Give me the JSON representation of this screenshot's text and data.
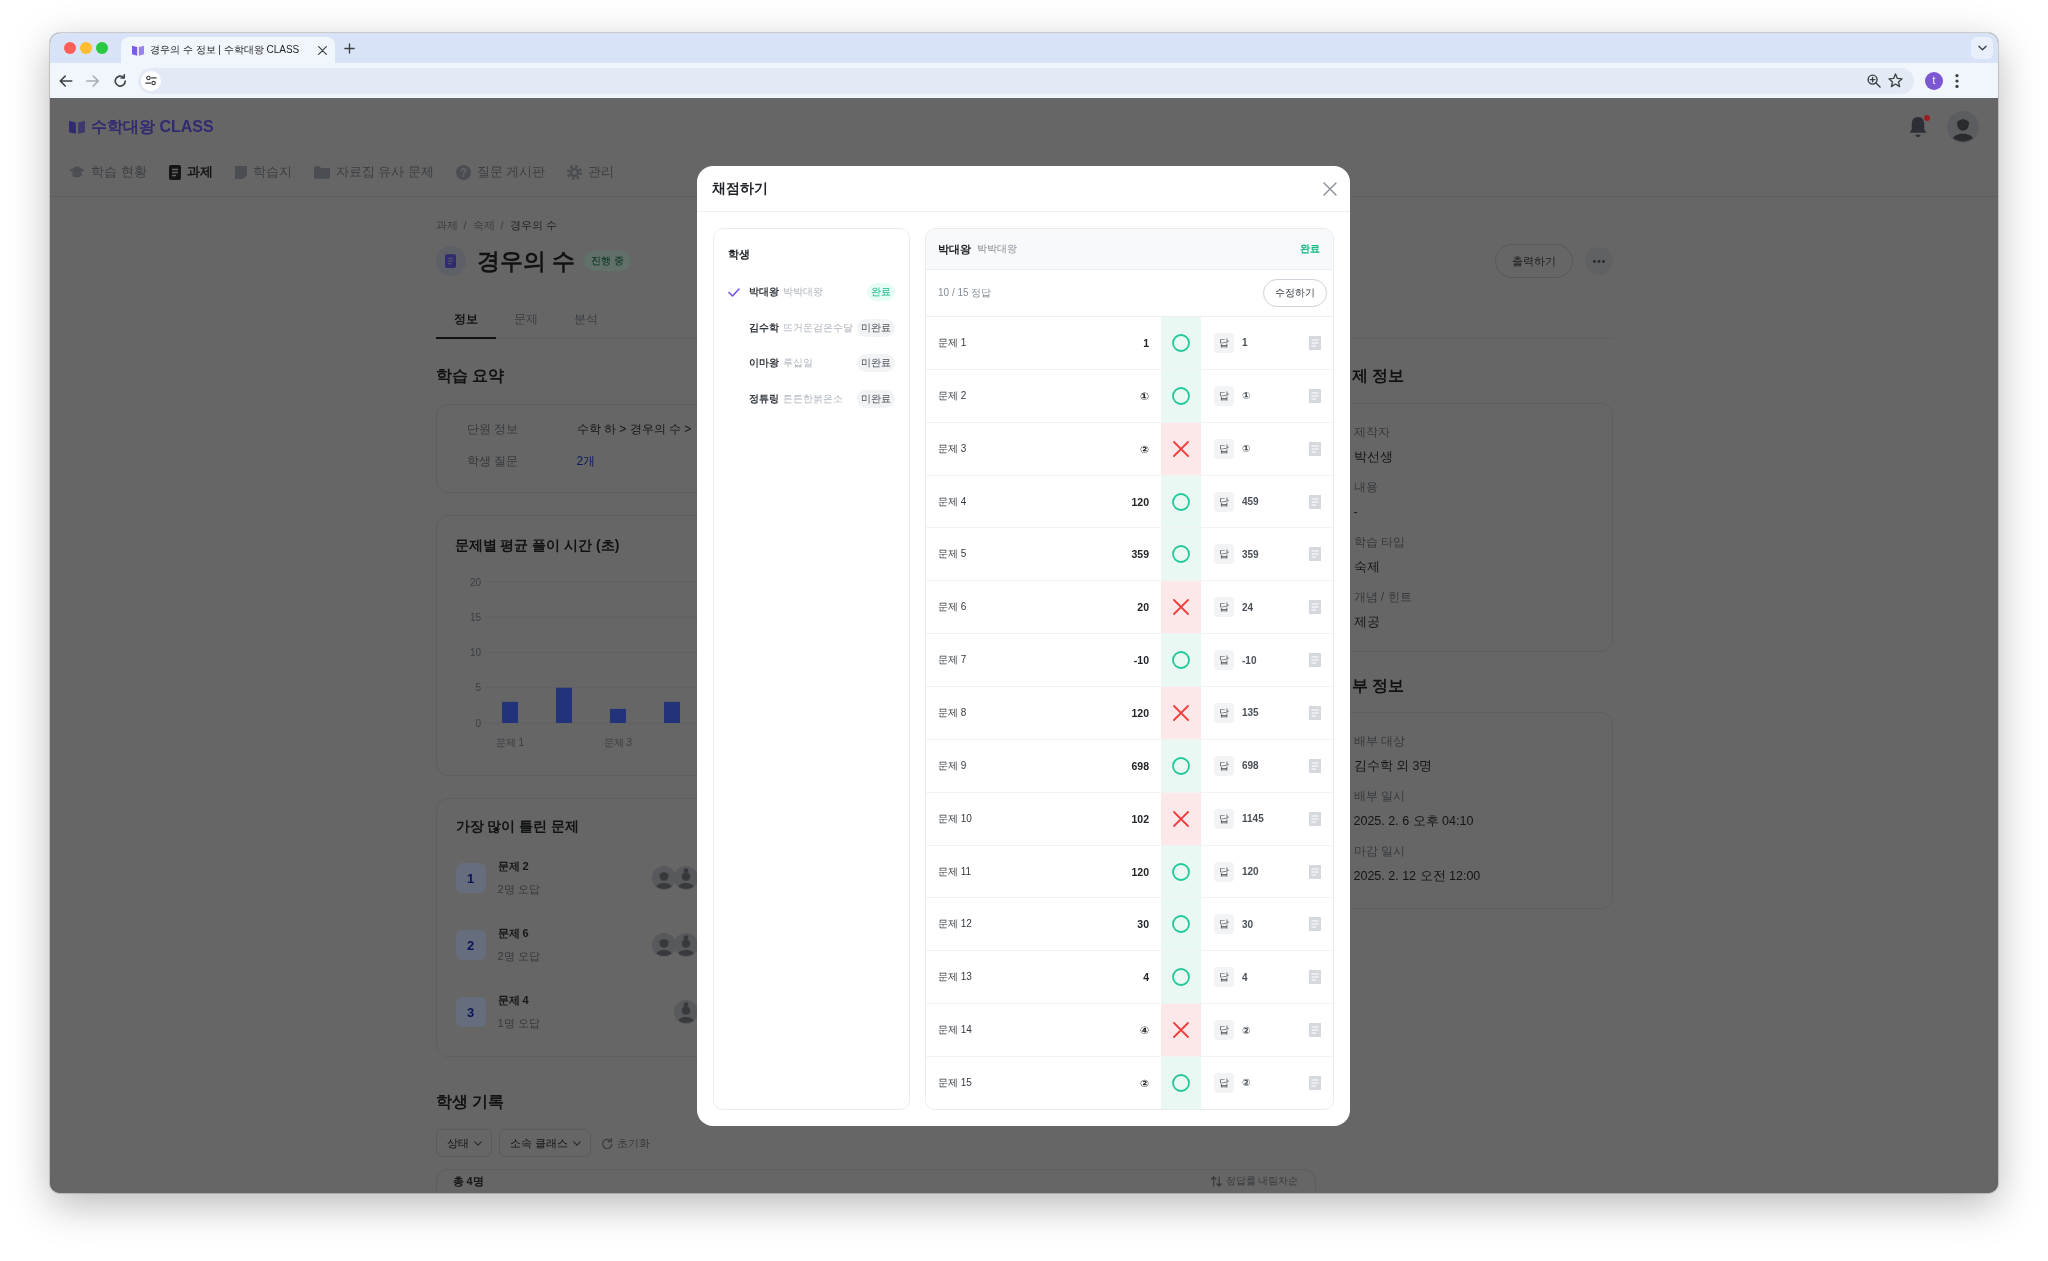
{
  "browser": {
    "tab_title": "경우의 수 정보 | 수학대왕 CLASS",
    "can_go_forward": false,
    "profile_initial": "t"
  },
  "header": {
    "logo": "수학대왕 CLASS",
    "has_notification": true,
    "nav": [
      {
        "label": "학습 현황",
        "selected": false
      },
      {
        "label": "과제",
        "selected": true
      },
      {
        "label": "학습지",
        "selected": false
      },
      {
        "label": "자료집 유사 문제",
        "selected": false
      },
      {
        "label": "질문 게시판",
        "selected": false
      },
      {
        "label": "관리",
        "selected": false
      }
    ]
  },
  "page": {
    "breadcrumb": [
      {
        "kind": "link",
        "text": "과제"
      },
      {
        "kind": "separator",
        "text": "/"
      },
      {
        "kind": "link",
        "text": "숙제"
      },
      {
        "kind": "separator",
        "text": "/"
      },
      {
        "kind": "current",
        "text": "경우의 수"
      }
    ],
    "title": "경우의 수",
    "status": "진행 중",
    "print_button": "출력하기",
    "tabs": [
      {
        "label": "정보",
        "selected": true
      },
      {
        "label": "문제",
        "selected": false
      },
      {
        "label": "분석",
        "selected": false
      }
    ]
  },
  "summary": {
    "heading": "학습 요약",
    "rows": [
      {
        "kind": "text",
        "label": "단원 정보",
        "value": "수학 하 > 경우의 수 >"
      },
      {
        "kind": "link",
        "label": "학생 질문",
        "value": "2개"
      }
    ]
  },
  "time_chart": {
    "chart_data": {
      "type": "bar",
      "title": "문제별 평균 풀이 시간 (초)",
      "categories": [
        "문제 1",
        null,
        "문제 3",
        null
      ],
      "values": [
        3,
        5,
        2,
        3
      ],
      "ylim": [
        0,
        20
      ],
      "yticks": [
        0,
        5,
        10,
        15,
        20
      ],
      "grid": true
    }
  },
  "most_wrong": {
    "heading": "가장 많이 틀린 문제",
    "items": [
      {
        "rank": "1",
        "problem": "문제 2",
        "detail": "2명 오답",
        "avatars": [
          {
            "kind": "short_hair"
          },
          {
            "kind": "bun_hair"
          }
        ]
      },
      {
        "rank": "2",
        "problem": "문제 6",
        "detail": "2명 오답",
        "avatars": [
          {
            "kind": "short_hair"
          },
          {
            "kind": "bun_hair"
          }
        ]
      },
      {
        "rank": "3",
        "problem": "문제 4",
        "detail": "1명 오답",
        "avatars": [
          {
            "kind": "bun_hair"
          }
        ]
      }
    ]
  },
  "records": {
    "heading": "학생 기록",
    "filters": [
      {
        "kind": "dropdown",
        "label": "상태"
      },
      {
        "kind": "dropdown",
        "label": "소속 클래스"
      },
      {
        "kind": "reset",
        "label": "초기화"
      }
    ],
    "total": "총 4명",
    "sort": "정답률 내림차순"
  },
  "details": {
    "heading": "제 정보",
    "fields": [
      {
        "label": "제작자",
        "value": "박선생"
      },
      {
        "label": "내용",
        "value": "-"
      },
      {
        "label": "학습 타입",
        "value": "숙제"
      },
      {
        "label": "개념 / 힌트",
        "value": "제공"
      }
    ]
  },
  "distribution": {
    "heading": "부 정보",
    "fields": [
      {
        "label": "배부 대상",
        "value": "김수학 외 3명"
      },
      {
        "label": "배부 일시",
        "value": "2025. 2. 6 오후 04:10"
      },
      {
        "label": "마감 일시",
        "value": "2025. 2. 12 오전 12:00"
      }
    ]
  },
  "grading": {
    "title": "채점하기",
    "students_heading": "학생",
    "students": [
      {
        "name": "박대왕",
        "nickname": "박박대왕",
        "status": "완료",
        "completed": true,
        "selected": true
      },
      {
        "name": "김수학",
        "nickname": "뜨거운검은수달",
        "status": "미완료",
        "completed": false,
        "selected": false
      },
      {
        "name": "이마왕",
        "nickname": "루십일",
        "status": "미완료",
        "completed": false,
        "selected": false
      },
      {
        "name": "정튜링",
        "nickname": "튼튼한붉은소",
        "status": "미완료",
        "completed": false,
        "selected": false
      }
    ],
    "detail": {
      "name": "박대왕",
      "nickname": "박박대왕",
      "status": "완료",
      "completed": true,
      "score": "10 / 15 정답",
      "edit_button": "수정하기",
      "rows": [
        {
          "label": "문제 1",
          "answer": "1",
          "correct": true,
          "key_label": "답",
          "key": "1"
        },
        {
          "label": "문제 2",
          "answer": "①",
          "correct": true,
          "key_label": "답",
          "key": "①"
        },
        {
          "label": "문제 3",
          "answer": "②",
          "correct": false,
          "key_label": "답",
          "key": "①"
        },
        {
          "label": "문제 4",
          "answer": "120",
          "correct": true,
          "key_label": "답",
          "key": "459"
        },
        {
          "label": "문제 5",
          "answer": "359",
          "correct": true,
          "key_label": "답",
          "key": "359"
        },
        {
          "label": "문제 6",
          "answer": "20",
          "correct": false,
          "key_label": "답",
          "key": "24"
        },
        {
          "label": "문제 7",
          "answer": "-10",
          "correct": true,
          "key_label": "답",
          "key": "-10"
        },
        {
          "label": "문제 8",
          "answer": "120",
          "correct": false,
          "key_label": "답",
          "key": "135"
        },
        {
          "label": "문제 9",
          "answer": "698",
          "correct": true,
          "key_label": "답",
          "key": "698"
        },
        {
          "label": "문제 10",
          "answer": "102",
          "correct": false,
          "key_label": "답",
          "key": "1145"
        },
        {
          "label": "문제 11",
          "answer": "120",
          "correct": true,
          "key_label": "답",
          "key": "120"
        },
        {
          "label": "문제 12",
          "answer": "30",
          "correct": true,
          "key_label": "답",
          "key": "30"
        },
        {
          "label": "문제 13",
          "answer": "4",
          "correct": true,
          "key_label": "답",
          "key": "4"
        },
        {
          "label": "문제 14",
          "answer": "④",
          "correct": false,
          "key_label": "답",
          "key": "②"
        },
        {
          "label": "문제 15",
          "answer": "②",
          "correct": true,
          "key_label": "답",
          "key": "②"
        }
      ]
    }
  }
}
